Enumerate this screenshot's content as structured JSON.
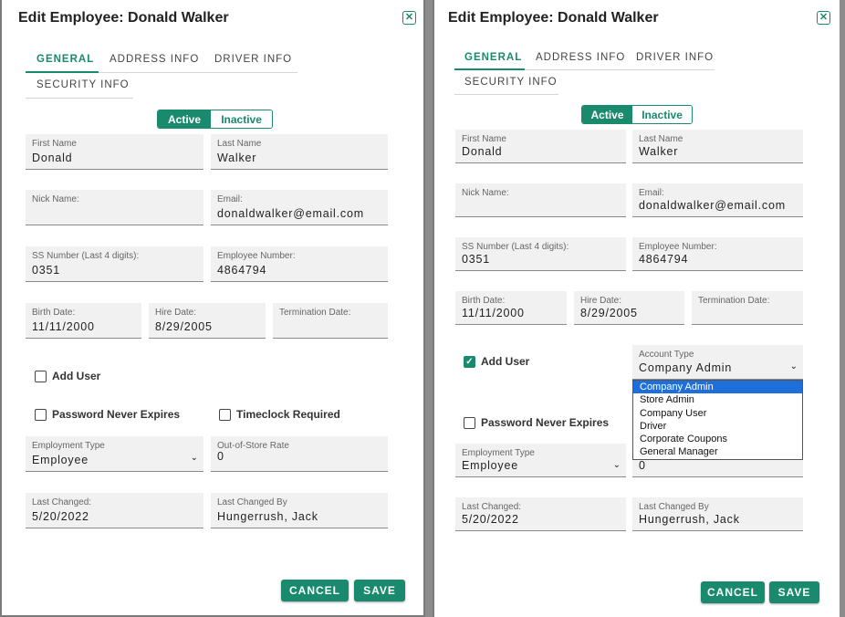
{
  "left": {
    "title": "Edit Employee: Donald Walker",
    "tabs": [
      "GENERAL",
      "ADDRESS INFO",
      "DRIVER INFO",
      "SECURITY INFO"
    ],
    "status": {
      "active": "Active",
      "inactive": "Inactive"
    },
    "fields": {
      "first_name": {
        "label": "First Name",
        "value": "Donald"
      },
      "last_name": {
        "label": "Last Name",
        "value": "Walker"
      },
      "nick_name": {
        "label": "Nick Name:",
        "value": ""
      },
      "email": {
        "label": "Email:",
        "value": "donaldwalker@email.com"
      },
      "ss_number": {
        "label": "SS Number (Last 4 digits):",
        "value": "0351"
      },
      "employee_number": {
        "label": "Employee Number:",
        "value": "4864794"
      },
      "birth_date": {
        "label": "Birth Date:",
        "value": "11/11/2000"
      },
      "hire_date": {
        "label": "Hire Date:",
        "value": "8/29/2005"
      },
      "termination_date": {
        "label": "Termination Date:",
        "value": ""
      },
      "employment_type": {
        "label": "Employment Type",
        "value": "Employee"
      },
      "out_of_store_rate": {
        "label": "Out-of-Store Rate",
        "value": "0"
      },
      "last_changed": {
        "label": "Last Changed:",
        "value": "5/20/2022"
      },
      "last_changed_by": {
        "label": "Last Changed By",
        "value": "Hungerrush, Jack"
      }
    },
    "checks": {
      "add_user": "Add User",
      "password_never_expires": "Password Never Expires",
      "timeclock_required": "Timeclock Required"
    },
    "buttons": {
      "cancel": "CANCEL",
      "save": "SAVE"
    }
  },
  "right": {
    "title": "Edit Employee: Donald Walker",
    "tabs": [
      "GENERAL",
      "ADDRESS INFO",
      "DRIVER INFO",
      "SECURITY INFO"
    ],
    "status": {
      "active": "Active",
      "inactive": "Inactive"
    },
    "fields": {
      "first_name": {
        "label": "First Name",
        "value": "Donald"
      },
      "last_name": {
        "label": "Last Name",
        "value": "Walker"
      },
      "nick_name": {
        "label": "Nick Name:",
        "value": ""
      },
      "email": {
        "label": "Email:",
        "value": "donaldwalker@email.com"
      },
      "ss_number": {
        "label": "SS Number (Last 4 digits):",
        "value": "0351"
      },
      "employee_number": {
        "label": "Employee Number:",
        "value": "4864794"
      },
      "birth_date": {
        "label": "Birth Date:",
        "value": "11/11/2000"
      },
      "hire_date": {
        "label": "Hire Date:",
        "value": "8/29/2005"
      },
      "termination_date": {
        "label": "Termination Date:",
        "value": ""
      },
      "account_type": {
        "label": "Account Type",
        "value": "Company Admin"
      },
      "employment_type": {
        "label": "Employment Type",
        "value": "Employee"
      },
      "out_of_store_rate": {
        "value": "0"
      },
      "last_changed": {
        "label": "Last Changed:",
        "value": "5/20/2022"
      },
      "last_changed_by": {
        "label": "Last Changed By",
        "value": "Hungerrush, Jack"
      }
    },
    "checks": {
      "add_user": "Add User",
      "password_never_expires": "Password Never Expires"
    },
    "account_type_options": [
      "Company Admin",
      "Store Admin",
      "Company User",
      "Driver",
      "Corporate Coupons",
      "General Manager"
    ],
    "buttons": {
      "cancel": "CANCEL",
      "save": "SAVE"
    }
  },
  "colors": {
    "accent": "#1a8a6e",
    "selected_option": "#1e6fd9"
  },
  "icons": {
    "close": "close-x-icon",
    "caret": "chevron-down-icon",
    "check": "checkmark-icon"
  }
}
